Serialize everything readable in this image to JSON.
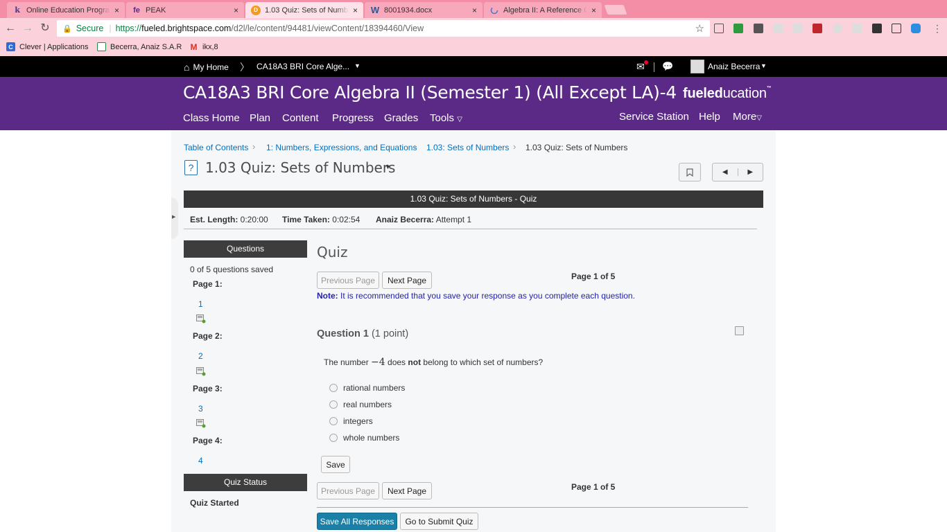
{
  "browser": {
    "tabs": [
      {
        "title": "Online Education Progra",
        "icon": "K12",
        "active": false
      },
      {
        "title": "PEAK",
        "icon": "fe",
        "active": false
      },
      {
        "title": "1.03 Quiz: Sets of Numbe",
        "icon": "D2L",
        "active": true
      },
      {
        "title": "8001934.docx",
        "icon": "W",
        "active": false
      },
      {
        "title": "Algebra II: A Reference Gu",
        "icon": "loading",
        "active": false
      }
    ],
    "close_glyph": "×",
    "secure_label": "Secure",
    "url_scheme": "https://",
    "url_host": "fueled.brightspace.com",
    "url_path": "/d2l/le/content/94481/viewContent/18394460/View",
    "bookmarks": [
      {
        "label": "Clever | Applications",
        "icon": "C"
      },
      {
        "label": "Becerra, Anaiz S.A.R",
        "icon": "sheets"
      },
      {
        "label": "ikx,8",
        "icon": "M"
      }
    ]
  },
  "minibar": {
    "home_label": "My Home",
    "course_label": "CA18A3 BRI Core Alge...",
    "user_name": "Anaiz Becerra"
  },
  "course": {
    "title": "CA18A3 BRI Core Algebra II (Semester 1) (All Except LA)-4",
    "logo_bold": "fueled",
    "logo_thin": "ucation",
    "logo_tm": "™",
    "nav_left": [
      "Class Home",
      "Plan",
      "Content",
      "Progress",
      "Grades",
      "Tools"
    ],
    "nav_right": [
      "Service Station",
      "Help",
      "More"
    ]
  },
  "breadcrumbs": [
    "Table of Contents",
    "1: Numbers, Expressions, and Equations",
    "1.03: Sets of Numbers",
    "1.03 Quiz: Sets of Numbers"
  ],
  "page": {
    "title": "1.03 Quiz: Sets of Numbers"
  },
  "quiz": {
    "header": "1.03 Quiz: Sets of Numbers - Quiz",
    "est_length_label": "Est. Length:",
    "est_length": "0:20:00",
    "time_taken_label": "Time Taken:",
    "time_taken": "0:02:54",
    "attempt_user": "Anaiz Becerra:",
    "attempt": "Attempt 1",
    "heading": "Quiz",
    "prev_label": "Previous Page",
    "next_label": "Next Page",
    "page_of": "Page 1 of 5",
    "note_label": "Note:",
    "note_text": "It is recommended that you save your response as you complete each question.",
    "save_label": "Save",
    "save_all_label": "Save All Responses",
    "submit_label": "Go to Submit Quiz"
  },
  "sidebar": {
    "questions_header": "Questions",
    "saved_text": "0 of 5 questions saved",
    "pages": [
      {
        "label": "Page 1:",
        "question": "1"
      },
      {
        "label": "Page 2:",
        "question": "2"
      },
      {
        "label": "Page 3:",
        "question": "3"
      },
      {
        "label": "Page 4:",
        "question": "4"
      }
    ],
    "status_header": "Quiz Status",
    "status_text": "Quiz Started"
  },
  "question": {
    "title": "Question 1",
    "points": "(1 point)",
    "text_before": "The number",
    "math": "−4",
    "text_mid": "does",
    "text_bold": "not",
    "text_after": "belong to which set of numbers?",
    "choices": [
      "rational numbers",
      "real numbers",
      "integers",
      "whole numbers"
    ]
  },
  "colors": {
    "tabbar": "#f48ea6",
    "course_header": "#5b2a86",
    "primary_button": "#1b80a7",
    "link": "#006fbf"
  }
}
